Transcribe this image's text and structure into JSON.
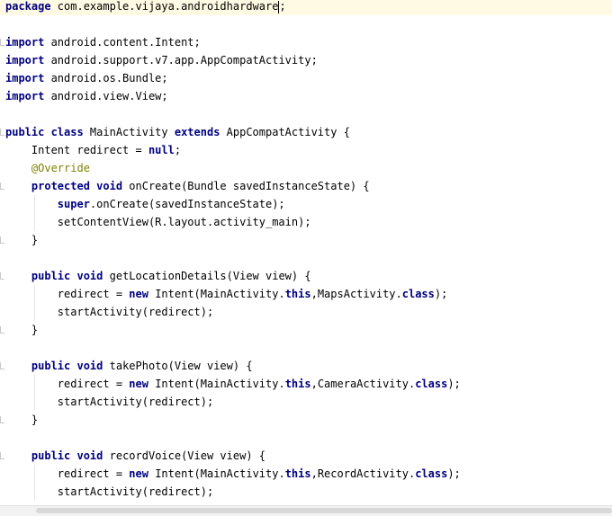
{
  "editor": {
    "lines": [
      {
        "tokens": [
          {
            "t": "package",
            "c": "kw"
          },
          {
            "t": " com.example.vijaya.androidhardware"
          },
          {
            "t": ";"
          }
        ],
        "caret": true
      },
      {
        "tokens": []
      },
      {
        "tokens": [
          {
            "t": "import",
            "c": "kw"
          },
          {
            "t": " android.content.Intent;"
          }
        ]
      },
      {
        "tokens": [
          {
            "t": "import",
            "c": "kw"
          },
          {
            "t": " android.support.v7.app.AppCompatActivity;"
          }
        ]
      },
      {
        "tokens": [
          {
            "t": "import",
            "c": "kw"
          },
          {
            "t": " android.os.Bundle;"
          }
        ]
      },
      {
        "tokens": [
          {
            "t": "import",
            "c": "kw"
          },
          {
            "t": " android.view.View;"
          }
        ]
      },
      {
        "tokens": []
      },
      {
        "tokens": [
          {
            "t": "public class",
            "c": "kw"
          },
          {
            "t": " MainActivity "
          },
          {
            "t": "extends",
            "c": "kw"
          },
          {
            "t": " AppCompatActivity {"
          }
        ]
      },
      {
        "tokens": [
          {
            "t": "    Intent redirect = "
          },
          {
            "t": "null",
            "c": "kw"
          },
          {
            "t": ";"
          }
        ]
      },
      {
        "tokens": [
          {
            "t": "    "
          },
          {
            "t": "@Override",
            "c": "ann"
          }
        ]
      },
      {
        "tokens": [
          {
            "t": "    "
          },
          {
            "t": "protected void",
            "c": "kw"
          },
          {
            "t": " onCreate(Bundle savedInstanceState) {"
          }
        ]
      },
      {
        "tokens": [
          {
            "t": "        "
          },
          {
            "t": "super",
            "c": "kw"
          },
          {
            "t": ".onCreate(savedInstanceState);"
          }
        ]
      },
      {
        "tokens": [
          {
            "t": "        setContentView(R.layout.activity_main);"
          }
        ]
      },
      {
        "tokens": [
          {
            "t": "    }"
          }
        ]
      },
      {
        "tokens": []
      },
      {
        "tokens": [
          {
            "t": "    "
          },
          {
            "t": "public void",
            "c": "kw"
          },
          {
            "t": " getLocationDetails(View view) {"
          }
        ]
      },
      {
        "tokens": [
          {
            "t": "        redirect = "
          },
          {
            "t": "new",
            "c": "kw"
          },
          {
            "t": " Intent(MainActivity."
          },
          {
            "t": "this",
            "c": "kw"
          },
          {
            "t": ",MapsActivity."
          },
          {
            "t": "class",
            "c": "kw"
          },
          {
            "t": ");"
          }
        ]
      },
      {
        "tokens": [
          {
            "t": "        startActivity(redirect);"
          }
        ]
      },
      {
        "tokens": [
          {
            "t": "    }"
          }
        ]
      },
      {
        "tokens": []
      },
      {
        "tokens": [
          {
            "t": "    "
          },
          {
            "t": "public void",
            "c": "kw"
          },
          {
            "t": " takePhoto(View view) {"
          }
        ]
      },
      {
        "tokens": [
          {
            "t": "        redirect = "
          },
          {
            "t": "new",
            "c": "kw"
          },
          {
            "t": " Intent(MainActivity."
          },
          {
            "t": "this",
            "c": "kw"
          },
          {
            "t": ",CameraActivity."
          },
          {
            "t": "class",
            "c": "kw"
          },
          {
            "t": ");"
          }
        ]
      },
      {
        "tokens": [
          {
            "t": "        startActivity(redirect);"
          }
        ]
      },
      {
        "tokens": [
          {
            "t": "    }"
          }
        ]
      },
      {
        "tokens": []
      },
      {
        "tokens": [
          {
            "t": "    "
          },
          {
            "t": "public void",
            "c": "kw"
          },
          {
            "t": " recordVoice(View view) {"
          }
        ]
      },
      {
        "tokens": [
          {
            "t": "        redirect = "
          },
          {
            "t": "new",
            "c": "kw"
          },
          {
            "t": " Intent(MainActivity."
          },
          {
            "t": "this",
            "c": "kw"
          },
          {
            "t": ",RecordActivity."
          },
          {
            "t": "class",
            "c": "kw"
          },
          {
            "t": ");"
          }
        ]
      },
      {
        "tokens": [
          {
            "t": "        startActivity(redirect);"
          }
        ]
      }
    ],
    "colors": {
      "keyword": "#000080",
      "annotation": "#808000",
      "text": "#000000",
      "current_line": "#fffae3"
    }
  }
}
